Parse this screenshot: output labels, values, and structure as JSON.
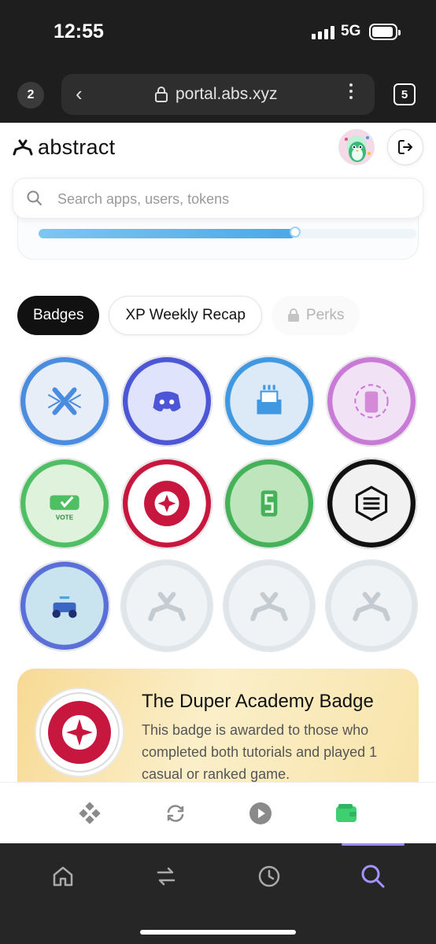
{
  "status_bar": {
    "time": "12:55",
    "network": "5G"
  },
  "browser": {
    "tab_count_left": "2",
    "url": "portal.abs.xyz",
    "tab_count_right": "5"
  },
  "header": {
    "logo_text": "abstract"
  },
  "search": {
    "placeholder": "Search apps, users, tokens",
    "value": ""
  },
  "progress": {
    "fraction": 0.68
  },
  "filters": [
    {
      "label": "Badges",
      "state": "active"
    },
    {
      "label": "XP Weekly Recap",
      "state": "normal"
    },
    {
      "label": "Perks",
      "state": "locked"
    }
  ],
  "badges": [
    {
      "name": "x-badge",
      "icon": "x-logo-icon",
      "ring": "#4a8de0",
      "fill": "#e8eef7",
      "unlocked": true
    },
    {
      "name": "discord-badge",
      "icon": "discord-icon",
      "ring": "#4d56d6",
      "fill": "#dfe3fb",
      "unlocked": true
    },
    {
      "name": "ballot-badge",
      "icon": "ballot-box-icon",
      "ring": "#3f98e0",
      "fill": "#dceaf8",
      "unlocked": true
    },
    {
      "name": "phone-cycle-badge",
      "icon": "phone-cycle-icon",
      "ring": "#c97ad7",
      "fill": "#f2e2f5",
      "unlocked": true
    },
    {
      "name": "vote-badge",
      "icon": "vote-card-icon",
      "ring": "#4fbf63",
      "fill": "#dff2dc",
      "unlocked": true
    },
    {
      "name": "duper-academy-badge",
      "icon": "star-compass-icon",
      "ring": "#c8173f",
      "fill": "#ffffff",
      "unlocked": true
    },
    {
      "name": "s-card-badge",
      "icon": "s-card-icon",
      "ring": "#45b25a",
      "fill": "#bfe5bd",
      "unlocked": true
    },
    {
      "name": "cube-badge",
      "icon": "cube-logo-icon",
      "ring": "#111111",
      "fill": "#f1f1f1",
      "unlocked": true
    },
    {
      "name": "race-car-badge",
      "icon": "race-car-icon",
      "ring": "#5b6fd9",
      "fill": "#c9e4ee",
      "unlocked": true
    },
    {
      "name": "locked-badge-1",
      "icon": "abstract-logo-icon",
      "ring": "#dfe5e9",
      "fill": "#f0f3f5",
      "unlocked": false
    },
    {
      "name": "locked-badge-2",
      "icon": "abstract-logo-icon",
      "ring": "#dfe5e9",
      "fill": "#f0f3f5",
      "unlocked": false
    },
    {
      "name": "locked-badge-3",
      "icon": "abstract-logo-icon",
      "ring": "#dfe5e9",
      "fill": "#f0f3f5",
      "unlocked": false
    }
  ],
  "detail": {
    "title": "The Duper Academy Badge",
    "description": "This badge is awarded to those who completed both tutorials and played 1 casual or ranked game."
  },
  "app_nav": [
    {
      "icon": "grid-diamond-icon",
      "active": false
    },
    {
      "icon": "swap-cycle-icon",
      "active": false
    },
    {
      "icon": "play-icon",
      "active": false
    },
    {
      "icon": "wallet-icon",
      "active": true
    }
  ],
  "browser_nav": [
    {
      "icon": "home-icon",
      "active": false
    },
    {
      "icon": "transfer-icon",
      "active": false
    },
    {
      "icon": "history-icon",
      "active": false
    },
    {
      "icon": "search-icon",
      "active": true
    }
  ],
  "colors": {
    "accent_green": "#3ecf72",
    "accent_purple": "#9b8cff",
    "brand_black": "#111111"
  }
}
